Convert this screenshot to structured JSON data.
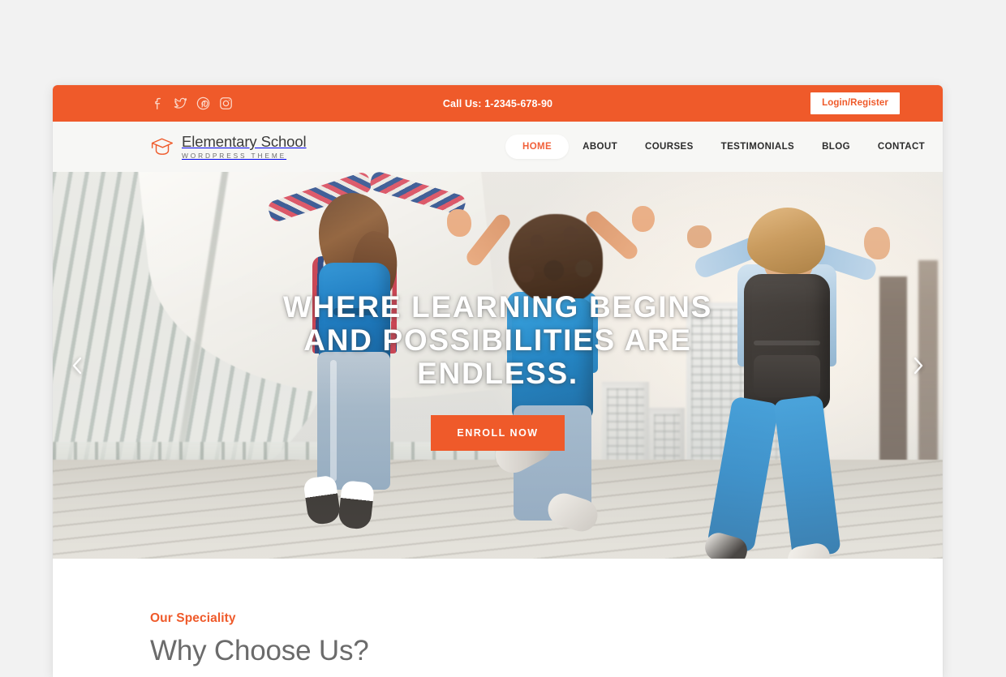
{
  "topbar": {
    "social": [
      {
        "name": "facebook-icon",
        "label": "Facebook"
      },
      {
        "name": "twitter-icon",
        "label": "Twitter"
      },
      {
        "name": "pinterest-icon",
        "label": "Pinterest"
      },
      {
        "name": "instagram-icon",
        "label": "Instagram"
      }
    ],
    "phone": "Call Us: 1-2345-678-90",
    "login_label": "Login/Register",
    "background_color": "#ef5a2a"
  },
  "header": {
    "logo": {
      "icon": "graduation-cap-icon",
      "name": "Elementary School",
      "tagline": "WORDPRESS THEME"
    },
    "nav": [
      {
        "label": "HOME",
        "active": true
      },
      {
        "label": "ABOUT",
        "active": false
      },
      {
        "label": "COURSES",
        "active": false
      },
      {
        "label": "TESTIMONIALS",
        "active": false
      },
      {
        "label": "BLOG",
        "active": false
      },
      {
        "label": "CONTACT",
        "active": false
      }
    ],
    "search_icon": "search-icon",
    "background_color": "#f7f7f5"
  },
  "hero": {
    "title_line1": "WHERE LEARNING BEGINS",
    "title_line2": "AND POSSIBILITIES ARE",
    "title_line3": "ENDLESS.",
    "cta_label": "ENROLL NOW",
    "prev_icon": "chevron-left-icon",
    "next_icon": "chevron-right-icon",
    "accent_color": "#ef5a2a",
    "image_alt": "Three children with backpacks jumping in the air on a boardwalk with a city skyline behind them"
  },
  "speciality": {
    "eyebrow": "Our Speciality",
    "heading": "Why Choose Us?",
    "eyebrow_color": "#ef5a2a",
    "heading_color": "#6b6b6b"
  },
  "page": {
    "background_color": "#f2f2f2"
  }
}
